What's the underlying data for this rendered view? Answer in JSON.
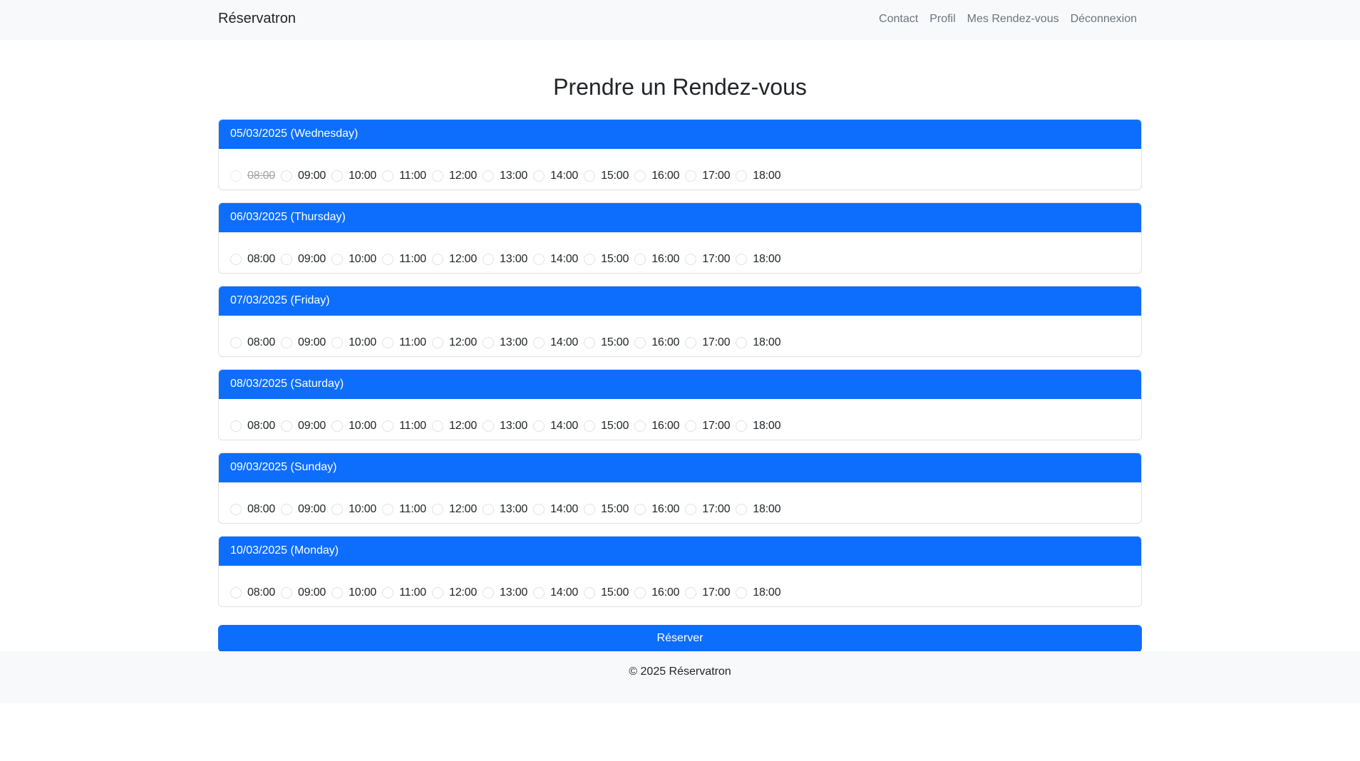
{
  "navbar": {
    "brand": "Réservatron",
    "links": [
      "Contact",
      "Profil",
      "Mes Rendez-vous",
      "Déconnexion"
    ]
  },
  "page": {
    "title": "Prendre un Rendez-vous"
  },
  "days": [
    {
      "label": "05/03/2025 (Wednesday)",
      "slots": [
        "08:00",
        "09:00",
        "10:00",
        "11:00",
        "12:00",
        "13:00",
        "14:00",
        "15:00",
        "16:00",
        "17:00",
        "18:00"
      ],
      "disabled_slots": [
        "08:00"
      ]
    },
    {
      "label": "06/03/2025 (Thursday)",
      "slots": [
        "08:00",
        "09:00",
        "10:00",
        "11:00",
        "12:00",
        "13:00",
        "14:00",
        "15:00",
        "16:00",
        "17:00",
        "18:00"
      ],
      "disabled_slots": []
    },
    {
      "label": "07/03/2025 (Friday)",
      "slots": [
        "08:00",
        "09:00",
        "10:00",
        "11:00",
        "12:00",
        "13:00",
        "14:00",
        "15:00",
        "16:00",
        "17:00",
        "18:00"
      ],
      "disabled_slots": []
    },
    {
      "label": "08/03/2025 (Saturday)",
      "slots": [
        "08:00",
        "09:00",
        "10:00",
        "11:00",
        "12:00",
        "13:00",
        "14:00",
        "15:00",
        "16:00",
        "17:00",
        "18:00"
      ],
      "disabled_slots": []
    },
    {
      "label": "09/03/2025 (Sunday)",
      "slots": [
        "08:00",
        "09:00",
        "10:00",
        "11:00",
        "12:00",
        "13:00",
        "14:00",
        "15:00",
        "16:00",
        "17:00",
        "18:00"
      ],
      "disabled_slots": []
    },
    {
      "label": "10/03/2025 (Monday)",
      "slots": [
        "08:00",
        "09:00",
        "10:00",
        "11:00",
        "12:00",
        "13:00",
        "14:00",
        "15:00",
        "16:00",
        "17:00",
        "18:00"
      ],
      "disabled_slots": []
    }
  ],
  "submit_label": "Réserver",
  "footer": {
    "text": "© 2025 Réservatron"
  },
  "colors": {
    "primary": "#0d6efd",
    "navbar_bg": "#f8f9fa",
    "text": "#212529",
    "muted": "#6c757d"
  }
}
